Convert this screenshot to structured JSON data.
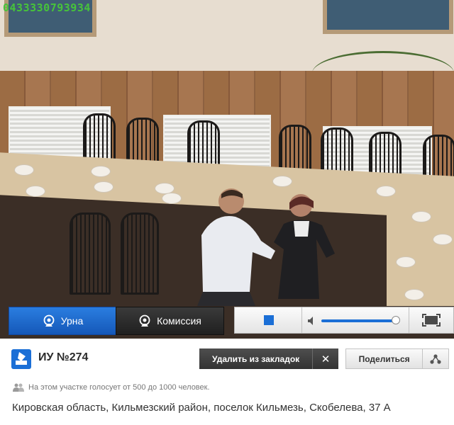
{
  "stream": {
    "id_overlay": "0433330793934"
  },
  "camera_tabs": [
    {
      "label": "Урна",
      "icon": "webcam-icon",
      "active": true
    },
    {
      "label": "Комиссия",
      "icon": "webcam-icon",
      "active": false
    }
  ],
  "player": {
    "stop_icon": "stop-icon",
    "volume_icon": "speaker-icon",
    "volume_level": 0.95,
    "fullscreen_icon": "fullscreen-icon"
  },
  "station": {
    "logo_icon": "ballot-box-icon",
    "title": "ИУ №274",
    "voters_text": "На этом участке голосует от 500 до 1000 человек.",
    "voters_icon": "people-icon",
    "address": "Кировская область, Кильмезский район, поселок Кильмезь, Скобелева, 37 А"
  },
  "actions": {
    "remove_bookmark_label": "Удалить из закладок",
    "remove_icon": "close-icon",
    "share_label": "Поделиться",
    "share_icon": "share-icon"
  },
  "colors": {
    "accent_blue": "#1b6fd6",
    "overlay_green": "#47c43a",
    "dark_button": "#333333"
  }
}
